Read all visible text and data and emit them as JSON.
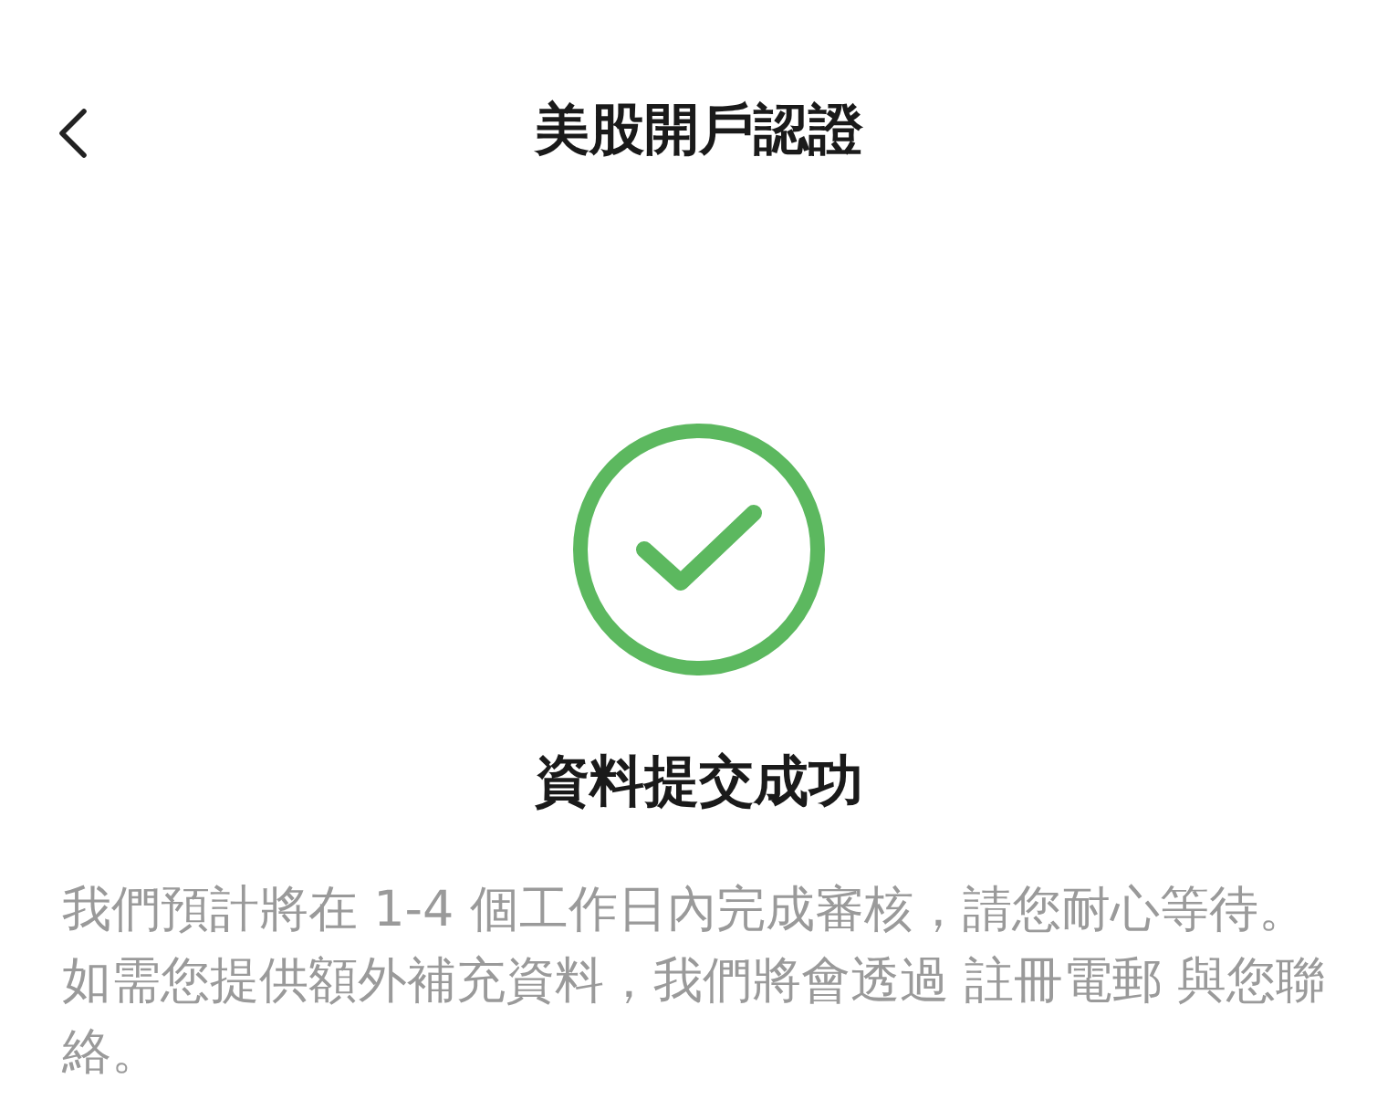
{
  "header": {
    "title": "美股開戶認證"
  },
  "result": {
    "title": "資料提交成功",
    "message": "我們預計將在 1-4 個工作日內完成審核，請您耐心等待。如需您提供額外補充資料，我們將會透過 註冊電郵 與您聯絡。"
  }
}
